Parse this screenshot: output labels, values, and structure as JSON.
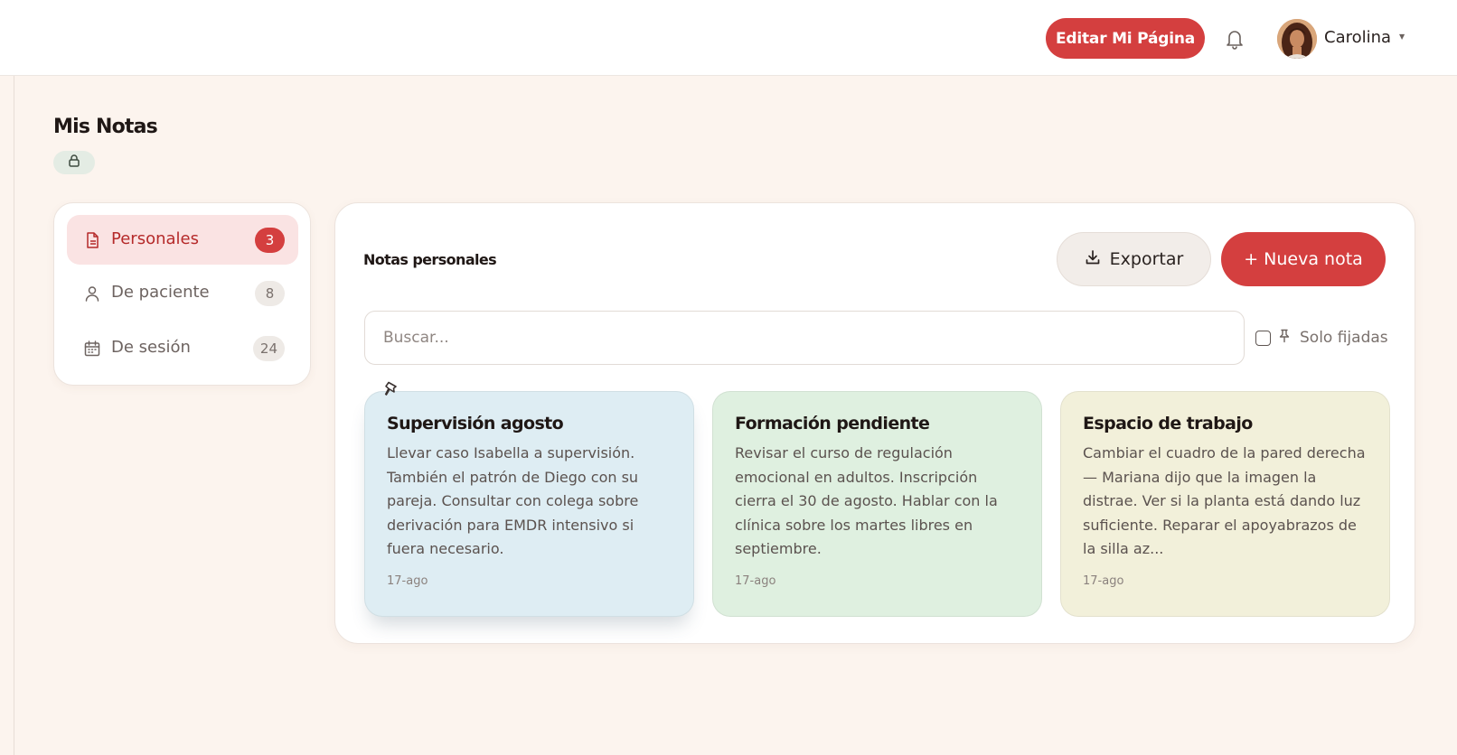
{
  "header": {
    "edit_button": "Editar Mi Página",
    "user_name": "Carolina",
    "bell_icon": "bell-icon",
    "caret_icon": "caret-down-icon"
  },
  "page": {
    "title": "Mis Notas",
    "privacy_icon": "lock-icon"
  },
  "sidebar": {
    "items": [
      {
        "label": "Personales",
        "count": "3",
        "icon": "document-icon",
        "active": true
      },
      {
        "label": "De paciente",
        "count": "8",
        "icon": "person-icon",
        "active": false
      },
      {
        "label": "De sesión",
        "count": "24",
        "icon": "calendar-icon",
        "active": false
      }
    ]
  },
  "main": {
    "section_title": "Notas personales",
    "export_label": "Exportar",
    "new_note_label": "+ Nueva nota",
    "search_placeholder": "Buscar...",
    "pinned_only_label": "Solo fijadas",
    "pinned_only_checked": false
  },
  "notes": [
    {
      "title": "Supervisión agosto",
      "body": "Llevar caso Isabella a supervisión. También el patrón de Diego con su pareja. Consultar con colega sobre derivación para EMDR intensivo si fuera necesario.",
      "date": "17-ago",
      "pinned": true,
      "color": "#deedf3"
    },
    {
      "title": "Formación pendiente",
      "body": "Revisar el curso de regulación emocional en adultos. Inscripción cierra el 30 de agosto. Hablar con la clínica sobre los martes libres en septiembre.",
      "date": "17-ago",
      "pinned": false,
      "color": "#dff0e0"
    },
    {
      "title": "Espacio de trabajo",
      "body": "Cambiar el cuadro de la pared derecha — Mariana dijo que la imagen la distrae. Ver si la planta está dando luz suficiente. Reparar el apoyabrazos de la silla az...",
      "date": "17-ago",
      "pinned": false,
      "color": "#f2f0da"
    }
  ],
  "colors": {
    "accent": "#d43f3f",
    "background": "#fcf4ee",
    "active_item_bg": "#fae3e3"
  }
}
